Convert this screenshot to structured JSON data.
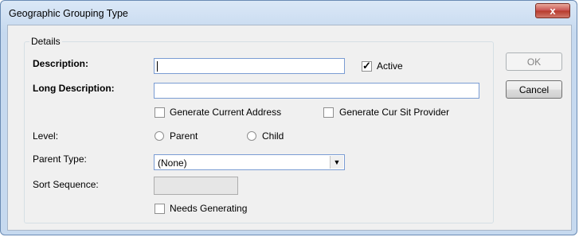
{
  "window": {
    "title": "Geographic Grouping Type",
    "close_glyph": "x"
  },
  "details": {
    "legend": "Details",
    "description_label": "Description:",
    "description_value": "",
    "active_label": "Active",
    "active_checked": true,
    "long_description_label": "Long Description:",
    "long_description_value": "",
    "generate_current_address_label": "Generate Current Address",
    "generate_cur_sit_provider_label": "Generate Cur Sit Provider",
    "level_label": "Level:",
    "level_options": [
      "Parent",
      "Child"
    ],
    "parent_type_label": "Parent Type:",
    "parent_type_value": "(None)",
    "sort_sequence_label": "Sort Sequence:",
    "sort_sequence_value": "",
    "needs_generating_label": "Needs Generating"
  },
  "buttons": {
    "ok": "OK",
    "cancel": "Cancel"
  }
}
